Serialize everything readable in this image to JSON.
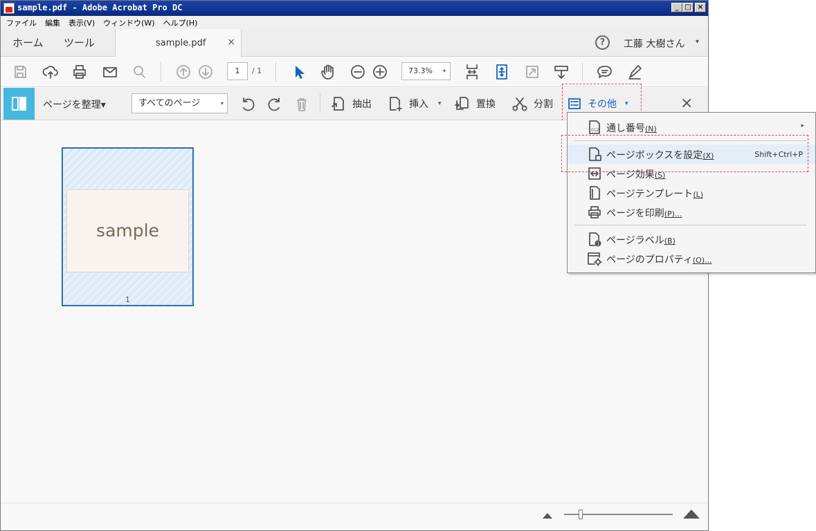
{
  "window": {
    "title": "sample.pdf - Adobe Acrobat Pro DC",
    "min_label": "_",
    "max_label": "□",
    "close_label": "×"
  },
  "menubar": [
    "ファイル",
    "編集",
    "表示(V)",
    "ウィンドウ(W)",
    "ヘルプ(H)"
  ],
  "nav": {
    "home": "ホーム",
    "tools": "ツール",
    "doc_tab": "sample.pdf",
    "tab_close": "×",
    "help": "?",
    "user": "工藤 大樹さん",
    "user_chevron": "▾"
  },
  "toolbar": {
    "page_current": "1",
    "page_total": "/ 1",
    "zoom": "73.3%",
    "zoom_chevron": "▾"
  },
  "organize": {
    "title": "ページを整理▾",
    "page_select": "すべてのページ",
    "page_select_chevron": "▾",
    "extract": "抽出",
    "insert": "挿入",
    "insert_chevron": "▾",
    "replace": "置換",
    "split": "分割",
    "more": "その他",
    "more_chevron": "▾",
    "close": "×"
  },
  "thumbnail": {
    "content_text": "sample",
    "page_number": "1"
  },
  "menu": {
    "items": [
      {
        "label": "通し番号",
        "accel": "(N)",
        "submenu": "▸"
      },
      {
        "label": "ページボックスを設定",
        "accel": "(X)",
        "shortcut": "Shift+Ctrl+P"
      },
      {
        "label": "ページ効果",
        "accel": "(S)"
      },
      {
        "label": "ページテンプレート",
        "accel": "(L)"
      },
      {
        "label": "ページを印刷",
        "accel": "(P)..."
      },
      {
        "label": "ページラベル",
        "accel": "(B)"
      },
      {
        "label": "ページのプロパティ",
        "accel": "(O)..."
      }
    ]
  },
  "colors": {
    "accent": "#1565c0",
    "highlight_border": "#e0445a",
    "organize_icon_bg": "#45b7e0",
    "selected_thumb": "#2f6fbf"
  }
}
